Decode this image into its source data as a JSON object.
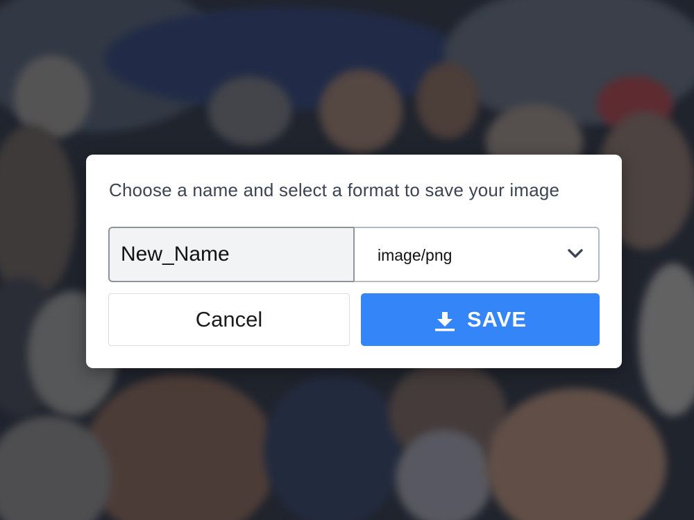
{
  "colors": {
    "accent": "#3485f7",
    "dialog_bg": "#ffffff",
    "input_bg": "#f2f3f5",
    "text": "#3d4452"
  },
  "dialog": {
    "prompt": "Choose a name and select a format to save your image",
    "name_input": {
      "value": "New_Name"
    },
    "format_select": {
      "selected": "image/png",
      "icon": "chevron-down-icon"
    },
    "cancel_label": "Cancel",
    "save_label": "SAVE",
    "save_icon": "download-icon"
  }
}
